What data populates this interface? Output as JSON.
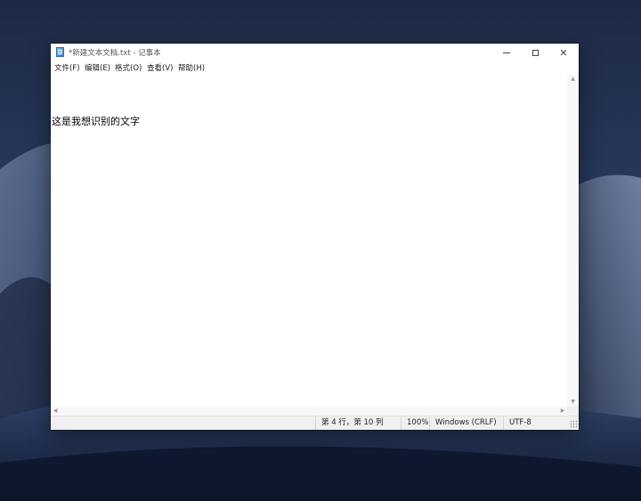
{
  "window": {
    "title": "*新建文本文档.txt - 记事本",
    "icon": "notepad-icon",
    "controls": {
      "minimize": "minimize-icon",
      "maximize": "maximize-icon",
      "close": "✕"
    }
  },
  "menu": {
    "file": "文件(F)",
    "edit": "编辑(E)",
    "format": "格式(O)",
    "view": "查看(V)",
    "help": "帮助(H)"
  },
  "document": {
    "text": "这是我想识别的文字"
  },
  "scrollbars": {
    "up_arrow": "▲",
    "down_arrow": "▼",
    "left_arrow": "◀",
    "right_arrow": "▶"
  },
  "status": {
    "position": "第 4 行，第 10 列",
    "zoom": "100%",
    "line_ending": "Windows (CRLF)",
    "encoding": "UTF-8"
  },
  "colors": {
    "desktop": "#26375a",
    "window_bg": "#ffffff",
    "statusbar_bg": "#f0f0f0"
  }
}
